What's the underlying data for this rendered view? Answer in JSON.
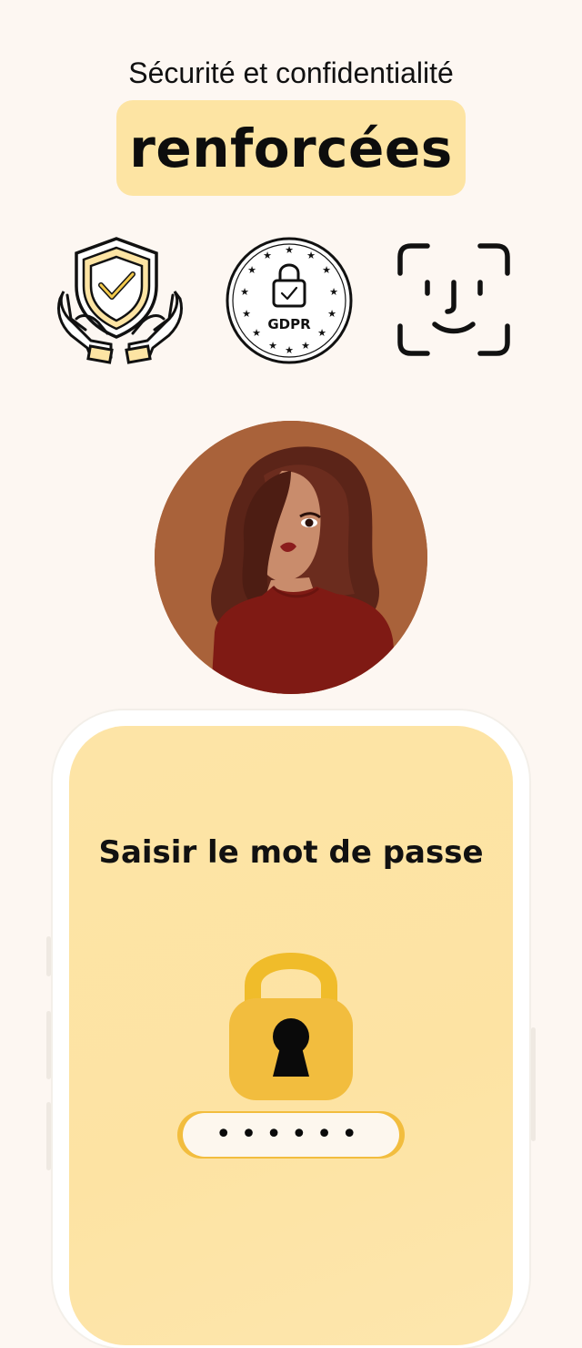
{
  "header": {
    "subtitle": "Sécurité et confidentialité",
    "highlight": "renforcées"
  },
  "badges": [
    {
      "icon": "shield-hands-icon"
    },
    {
      "icon": "gdpr-lock-icon",
      "label": "GDPR"
    },
    {
      "icon": "face-id-icon"
    }
  ],
  "profile": {
    "icon": "woman-portrait-avatar"
  },
  "phone": {
    "title": "Saisir le mot de passe",
    "lock_icon": "padlock-icon",
    "password_mask": "••••••"
  },
  "colors": {
    "background": "#fdf7f2",
    "accent_yellow": "#fde4a3",
    "lock_gold": "#f2bd3e",
    "avatar_bg": "#a9623a",
    "sweater_red": "#7f1a14"
  }
}
